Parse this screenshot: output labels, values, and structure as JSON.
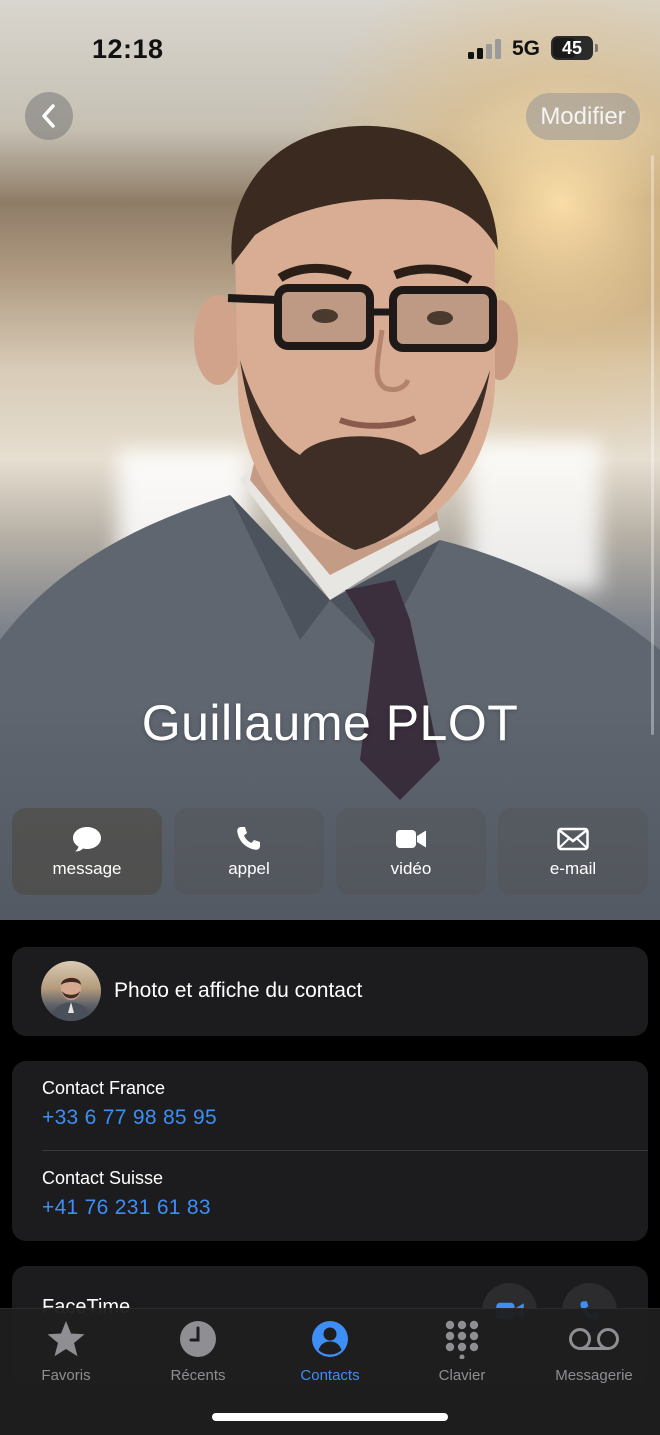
{
  "status_bar": {
    "time": "12:18",
    "network": "5G",
    "battery": "45"
  },
  "header": {
    "edit_label": "Modifier"
  },
  "contact": {
    "name": "Guillaume PLOT"
  },
  "actions": [
    {
      "label": "message",
      "icon": "message-bubble-icon"
    },
    {
      "label": "appel",
      "icon": "phone-icon"
    },
    {
      "label": "vidéo",
      "icon": "video-camera-icon"
    },
    {
      "label": "e-mail",
      "icon": "envelope-icon"
    }
  ],
  "photo_poster": {
    "label": "Photo et affiche du contact"
  },
  "phones": [
    {
      "label": "Contact France",
      "number": "+33 6 77 98 85 95"
    },
    {
      "label": "Contact Suisse",
      "number": "+41 76 231 61 83"
    }
  ],
  "facetime": {
    "label": "FaceTime"
  },
  "tabs": [
    {
      "label": "Favoris",
      "icon": "star-icon",
      "active": false
    },
    {
      "label": "Récents",
      "icon": "clock-icon",
      "active": false
    },
    {
      "label": "Contacts",
      "icon": "person-circle-icon",
      "active": true
    },
    {
      "label": "Clavier",
      "icon": "keypad-icon",
      "active": false
    },
    {
      "label": "Messagerie",
      "icon": "voicemail-icon",
      "active": false
    }
  ],
  "colors": {
    "accent": "#3d8ef5",
    "card_bg": "#1c1c1e",
    "page_bg": "#000000"
  }
}
